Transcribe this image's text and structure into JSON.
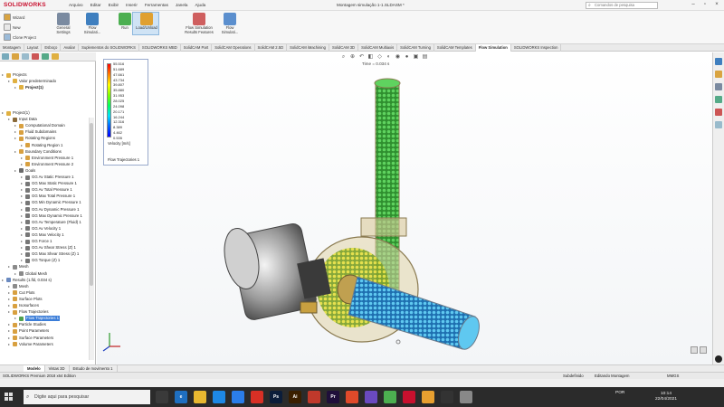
{
  "app": {
    "logo": "SOLIDWORKS",
    "menu": [
      "Arquivo",
      "Editar",
      "Exibir",
      "Inserir",
      "Ferramentas",
      "Janela",
      "Ajuda"
    ],
    "document_title": "Montagem simulação 1-1.SLDASM *",
    "search_placeholder": "Comandos de pesquisa"
  },
  "ribbon": {
    "small_buttons": [
      {
        "label": "Wizard",
        "color": "#d9a441"
      },
      {
        "label": "New",
        "color": "#e8e8e8"
      },
      {
        "label": "Clone Project",
        "color": "#9bbbd9"
      }
    ],
    "big_buttons": [
      {
        "label": "General Settings",
        "color": "#7a8aa0"
      },
      {
        "label": "Flow Simulati...",
        "color": "#3f7fbf"
      },
      {
        "label": "Run",
        "color": "#4caf50"
      },
      {
        "label": "Load/Unload",
        "color": "#e0a030"
      },
      {
        "label": "Flow Simulation Results Features",
        "color": "#cf5f5f"
      },
      {
        "label": "Flow Simulati...",
        "color": "#5b8fce"
      }
    ]
  },
  "command_tabs": [
    "Montagem",
    "Layout",
    "Esboço",
    "Avaliar",
    "Suplementos do SOLIDWORKS",
    "SOLIDWORKS MBD",
    "SolidCAM Part",
    "SolidCAM Operations",
    "SolidCAM 2.5D",
    "SolidCAM iMachining",
    "SolidCAM 3D",
    "SolidCAM Multiaxis",
    "SolidCAM Turning",
    "SolidCAM Templates",
    "Flow Simulation",
    "SOLIDWORKS Inspection"
  ],
  "active_command_tab": "Flow Simulation",
  "tree": {
    "top": [
      {
        "label": "Projects",
        "indent": 0,
        "color": "#e0b040"
      },
      {
        "label": "Valor predeterminado",
        "indent": 1,
        "color": "#e0b040"
      },
      {
        "label": "Project(1)",
        "indent": 2,
        "color": "#e0b040",
        "bold": true
      }
    ],
    "main": [
      {
        "label": "Project(1)",
        "indent": 0,
        "color": "#e0b040"
      },
      {
        "label": "Input Data",
        "indent": 1,
        "color": "#8a6a3a"
      },
      {
        "label": "Computational Domain",
        "indent": 2,
        "color": "#d8a040"
      },
      {
        "label": "Fluid Subdomains",
        "indent": 2,
        "color": "#d8a040"
      },
      {
        "label": "Rotating Regions",
        "indent": 2,
        "color": "#d8a040"
      },
      {
        "label": "Rotating Region 1",
        "indent": 3,
        "color": "#d8a040"
      },
      {
        "label": "Boundary Conditions",
        "indent": 2,
        "color": "#d8a040"
      },
      {
        "label": "Environment Pressure 1",
        "indent": 3,
        "color": "#d8a040"
      },
      {
        "label": "Environment Pressure 2",
        "indent": 3,
        "color": "#d8a040"
      },
      {
        "label": "Goals",
        "indent": 2,
        "color": "#6a6a6a"
      },
      {
        "label": "GG Av Static Pressure 1",
        "indent": 3,
        "color": "#777777"
      },
      {
        "label": "GG Max Static Pressure 1",
        "indent": 3,
        "color": "#777777"
      },
      {
        "label": "GG Av Total Pressure 1",
        "indent": 3,
        "color": "#777777"
      },
      {
        "label": "GG Max Total Pressure 1",
        "indent": 3,
        "color": "#777777"
      },
      {
        "label": "GG Min Dynamic Pressure 1",
        "indent": 3,
        "color": "#777777"
      },
      {
        "label": "GG Av Dynamic Pressure 1",
        "indent": 3,
        "color": "#777777"
      },
      {
        "label": "GG Max Dynamic Pressure 1",
        "indent": 3,
        "color": "#777777"
      },
      {
        "label": "GG Av Temperature (Fluid) 1",
        "indent": 3,
        "color": "#777777"
      },
      {
        "label": "GG Av Velocity 1",
        "indent": 3,
        "color": "#777777"
      },
      {
        "label": "GG Max Velocity 1",
        "indent": 3,
        "color": "#777777"
      },
      {
        "label": "GG Force 1",
        "indent": 3,
        "color": "#777777"
      },
      {
        "label": "GG Av Shear Stress (Z) 1",
        "indent": 3,
        "color": "#777777"
      },
      {
        "label": "GG Max Shear Stress (Z) 1",
        "indent": 3,
        "color": "#777777"
      },
      {
        "label": "GG Torque (Z) 1",
        "indent": 3,
        "color": "#777777"
      },
      {
        "label": "Mesh",
        "indent": 1,
        "color": "#8a8a8a"
      },
      {
        "label": "Global Mesh",
        "indent": 2,
        "color": "#8a8a8a"
      },
      {
        "label": "Results (1.fld, 0.034 s)",
        "indent": 0,
        "color": "#6a8ac0"
      },
      {
        "label": "Mesh",
        "indent": 1,
        "color": "#8a8a8a"
      },
      {
        "label": "Cut Plots",
        "indent": 1,
        "color": "#d8a040"
      },
      {
        "label": "Surface Plots",
        "indent": 1,
        "color": "#d8a040"
      },
      {
        "label": "Isosurfaces",
        "indent": 1,
        "color": "#d8a040"
      },
      {
        "label": "Flow Trajectories",
        "indent": 1,
        "color": "#d8a040"
      },
      {
        "label": "Flow Trajectories 1",
        "indent": 2,
        "color": "#50a050",
        "selected": true
      },
      {
        "label": "Particle Studies",
        "indent": 1,
        "color": "#d8a040"
      },
      {
        "label": "Point Parameters",
        "indent": 1,
        "color": "#d8a040"
      },
      {
        "label": "Surface Parameters",
        "indent": 1,
        "color": "#d8a040"
      },
      {
        "label": "Volume Parameters",
        "indent": 1,
        "color": "#d8a040"
      }
    ]
  },
  "viewport": {
    "time_label": "Time = 0.034 s"
  },
  "legend": {
    "values": [
      "55.516",
      "51.689",
      "47.661",
      "43.734",
      "39.807",
      "35.880",
      "31.953",
      "28.025",
      "24.098",
      "20.171",
      "16.244",
      "12.316",
      "8.389",
      "4.462",
      "0.535"
    ],
    "unit": "Velocity [m/s]",
    "name": "Flow Trajectories 1"
  },
  "model_tabs": [
    "Modelo",
    "Vistas 3D",
    "Estudo de movimento 1"
  ],
  "active_model_tab": "Modelo",
  "status": {
    "left": "SOLIDWORKS Premium 2018 x64 Edition",
    "mid1": "Subdefinido",
    "mid2": "Editando Montagem",
    "right": "MMGS"
  },
  "taskbar": {
    "search_placeholder": "Digite aqui para pesquisar",
    "apps": [
      {
        "label": "",
        "color": "#3a3a3a"
      },
      {
        "label": "e",
        "color": "#1f6fc0"
      },
      {
        "label": "",
        "color": "#e8b830"
      },
      {
        "label": "",
        "color": "#1e88e5"
      },
      {
        "label": "",
        "color": "#2b7de9"
      },
      {
        "label": "",
        "color": "#d93025"
      },
      {
        "label": "Ps",
        "color": "#0b1d3a"
      },
      {
        "label": "Ai",
        "color": "#3a1f00"
      },
      {
        "label": "",
        "color": "#c0392b"
      },
      {
        "label": "Pr",
        "color": "#1f0f3a"
      },
      {
        "label": "",
        "color": "#e04a2a"
      },
      {
        "label": "",
        "color": "#6a4ac0"
      },
      {
        "label": "",
        "color": "#4caf50"
      },
      {
        "label": "",
        "color": "#c8102e"
      },
      {
        "label": "",
        "color": "#e8a030"
      },
      {
        "label": "",
        "color": "#333333"
      },
      {
        "label": "",
        "color": "#888888"
      }
    ],
    "language": "POR",
    "time": "10:14",
    "date": "22/04/2021"
  }
}
